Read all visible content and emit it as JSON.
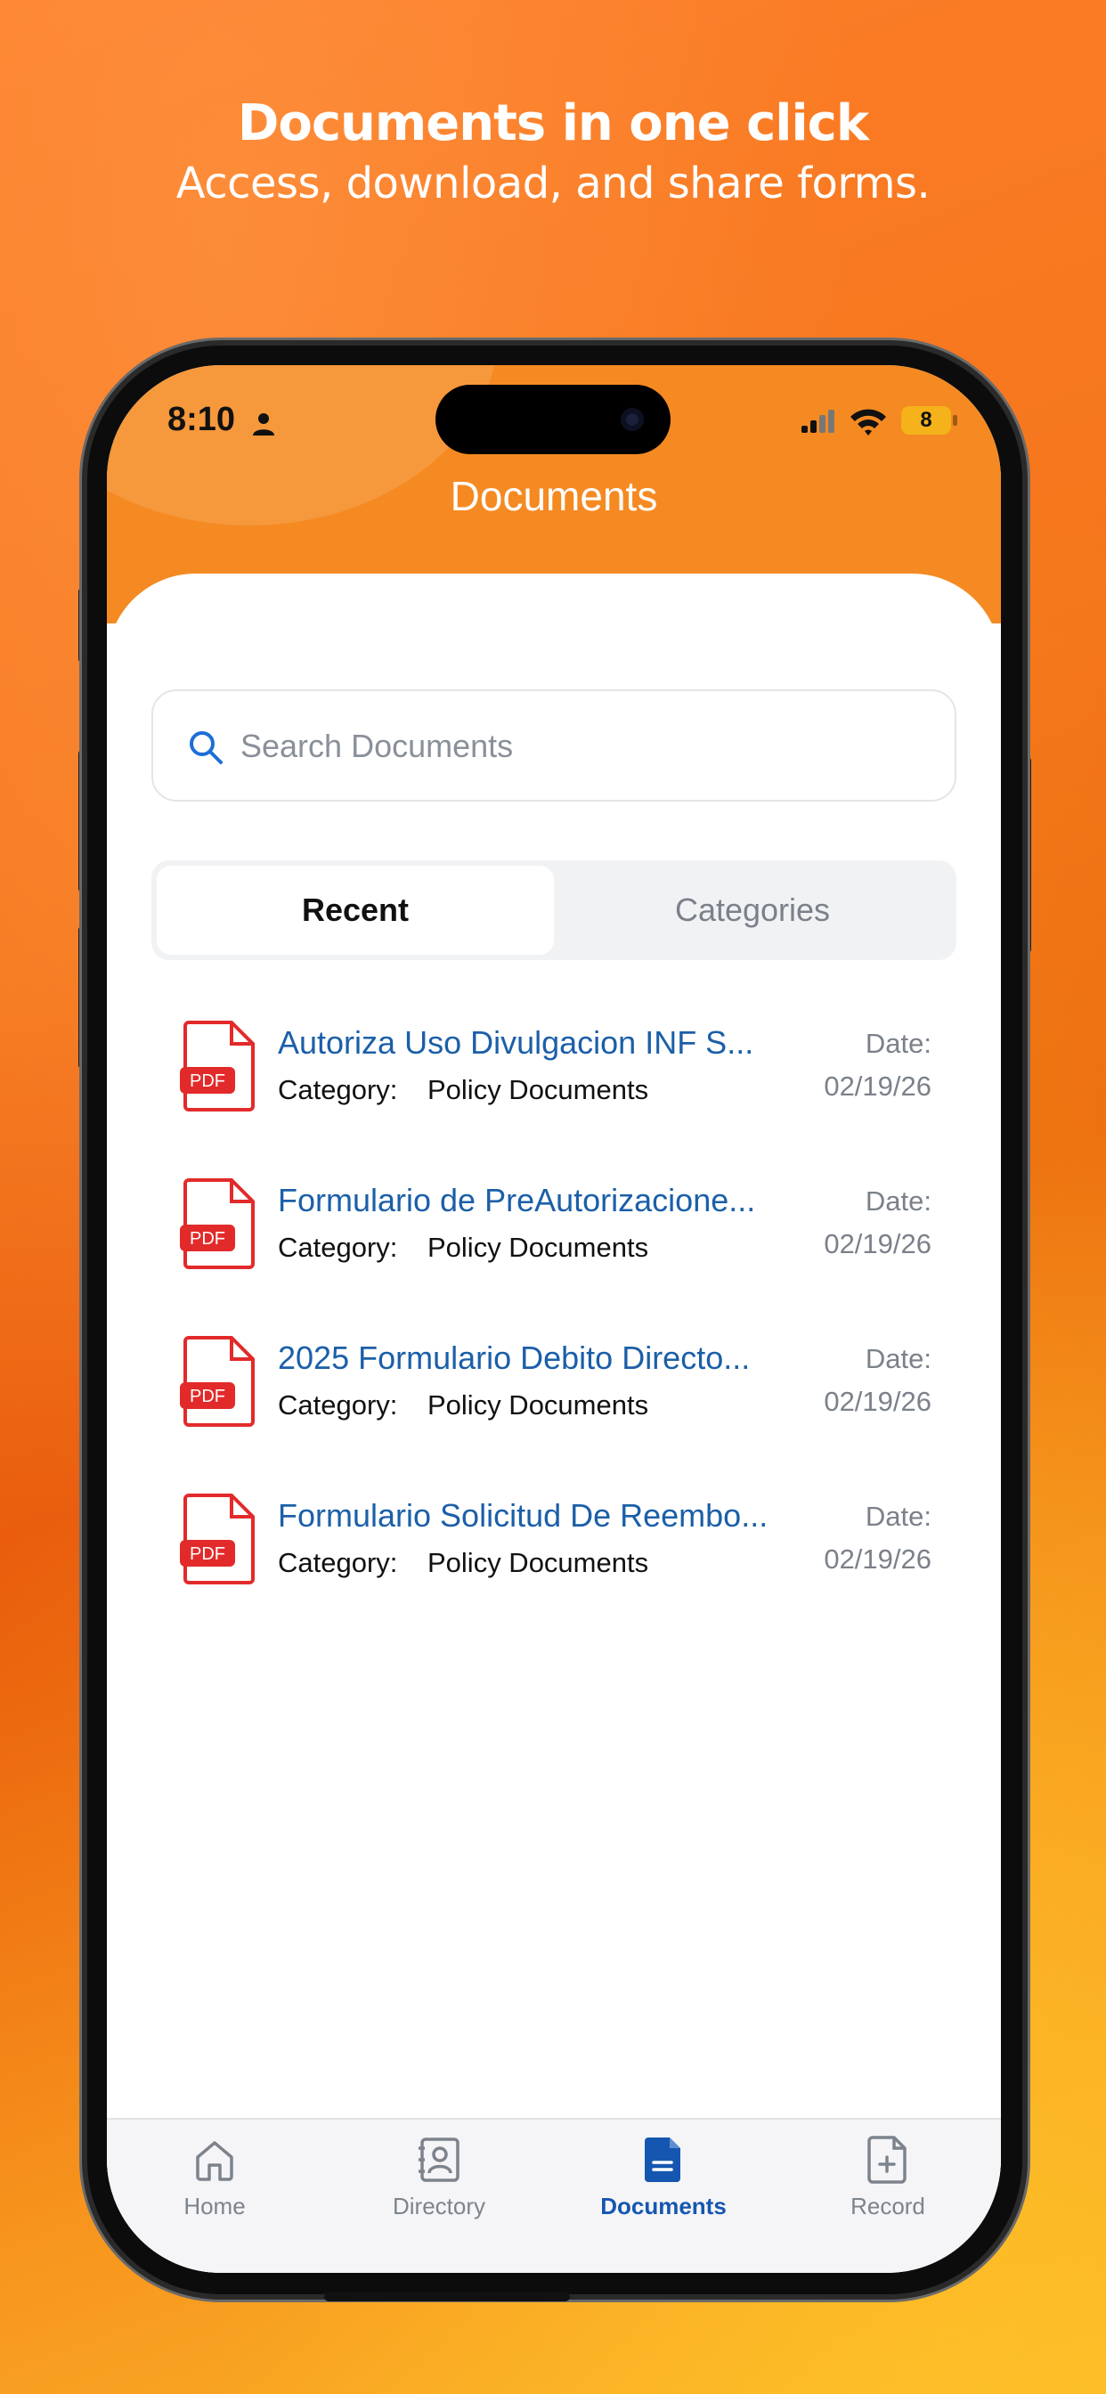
{
  "promo": {
    "headline": "Documents in one click",
    "subheadline": "Access, download, and share forms."
  },
  "status_bar": {
    "time": "8:10",
    "battery": "8"
  },
  "header": {
    "title": "Documents"
  },
  "search": {
    "placeholder": "Search Documents"
  },
  "segments": {
    "recent": "Recent",
    "categories": "Categories",
    "selected": "Recent"
  },
  "documents": [
    {
      "icon": "pdf-icon",
      "badge": "PDF",
      "name": "Autoriza Uso Divulgacion INF S...",
      "category_label": "Category:",
      "category": "Policy Documents",
      "date_label": "Date:",
      "date": "02/19/26"
    },
    {
      "icon": "pdf-icon",
      "badge": "PDF",
      "name": "Formulario de PreAutorizacione...",
      "category_label": "Category:",
      "category": "Policy Documents",
      "date_label": "Date:",
      "date": "02/19/26"
    },
    {
      "icon": "pdf-icon",
      "badge": "PDF",
      "name": "2025 Formulario Debito Directo...",
      "category_label": "Category:",
      "category": "Policy Documents",
      "date_label": "Date:",
      "date": "02/19/26"
    },
    {
      "icon": "pdf-icon",
      "badge": "PDF",
      "name": "Formulario Solicitud De Reembo...",
      "category_label": "Category:",
      "category": "Policy Documents",
      "date_label": "Date:",
      "date": "02/19/26"
    }
  ],
  "tabbar": [
    {
      "label": "Home",
      "icon": "home-icon",
      "active": false
    },
    {
      "label": "Directory",
      "icon": "directory-icon",
      "active": false
    },
    {
      "label": "Documents",
      "icon": "documents-icon",
      "active": true
    },
    {
      "label": "Record",
      "icon": "record-icon",
      "active": false
    }
  ],
  "colors": {
    "accent_orange": "#f58a22",
    "link_blue": "#1b5fa8",
    "active_tab_blue": "#1557b0",
    "pdf_red": "#e32a2a"
  }
}
